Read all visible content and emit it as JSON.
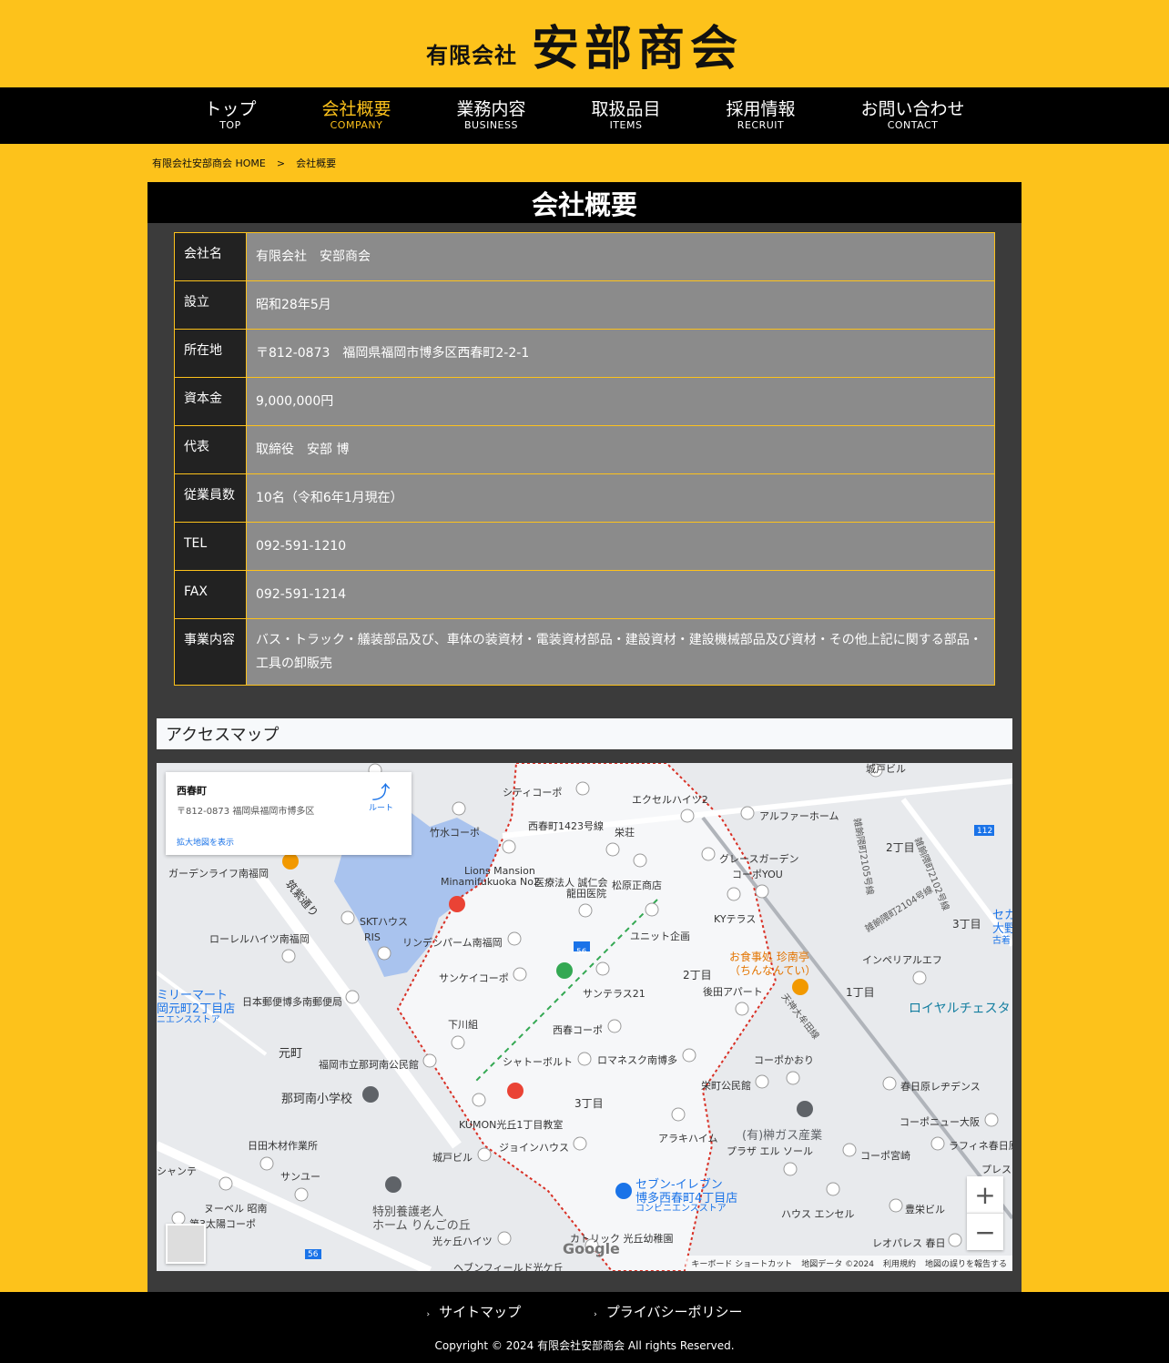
{
  "header": {
    "logo_small": "有限会社",
    "logo_big": "安部商会"
  },
  "nav": [
    {
      "jp": "トップ",
      "en": "TOP"
    },
    {
      "jp": "会社概要",
      "en": "COMPANY"
    },
    {
      "jp": "業務内容",
      "en": "BUSINESS"
    },
    {
      "jp": "取扱品目",
      "en": "ITEMS"
    },
    {
      "jp": "採用情報",
      "en": "RECRUIT"
    },
    {
      "jp": "お問い合わせ",
      "en": "CONTACT"
    }
  ],
  "breadcrumb": {
    "home": "有限会社安部商会 HOME",
    "separator": ">",
    "current": "会社概要"
  },
  "page_title": "会社概要",
  "company_table": [
    {
      "label": "会社名",
      "value": "有限会社　安部商会"
    },
    {
      "label": "設立",
      "value": "昭和28年5月"
    },
    {
      "label": "所在地",
      "value": "〒812-0873　福岡県福岡市博多区西春町2-2-1"
    },
    {
      "label": "資本金",
      "value": "9,000,000円"
    },
    {
      "label": "代表",
      "value": "取締役　安部 博"
    },
    {
      "label": "従業員数",
      "value": "10名（令和6年1月現在）"
    },
    {
      "label": "TEL",
      "value": "092-591-1210"
    },
    {
      "label": "FAX",
      "value": "092-591-1214"
    },
    {
      "label": "事業内容",
      "value": "バス・トラック・艤装部品及び、車体の装資材・電装資材部品・建設資材・建設機械部品及び資材・その他上記に関する部品・工具の卸販売"
    }
  ],
  "access": {
    "title": "アクセスマップ",
    "card": {
      "name": "西春町",
      "address": "〒812-0873 福岡県福岡市博多区",
      "link": "拡大地図を表示",
      "directions": "ルート"
    },
    "labels": {
      "l1": "シティコーポ",
      "l2": "エクセルハイツ2",
      "l3": "竹水コーポ",
      "l4": "西春町1423号線",
      "l5": "栄荘",
      "l6": "アルファーホーム",
      "l7": "グレースガーデン",
      "l8": "コーポYOU",
      "l9": "Lions Mansion",
      "l10": "Minamifukuoka No2",
      "l11": "医療法人 誠仁会",
      "l12": "龍田医院",
      "l13": "松原正商店",
      "l14": "ガーデンライフ南福岡",
      "l15": "SKTハウス",
      "l16": "RIS",
      "l17": "ローレルハイツ南福岡",
      "l18": "リンデンパーム南福岡",
      "l19": "ユニット企画",
      "l20": "KYテラス",
      "l21": "サンケイコーポ",
      "l22": "サンテラス21",
      "l23": "2丁目",
      "l24": "後田アパート",
      "l25": "インペリアルエフ",
      "l26": "1丁目",
      "l27": "3丁目",
      "l28": "2丁目",
      "l29": "日本郵便博多南郵便局",
      "l30": "下川組",
      "l31": "西春コーポ",
      "l32": "元町",
      "l33": "福岡市立那珂南公民館",
      "l34": "シャトーボルト",
      "l35": "ロマネスク南博多",
      "l36": "コーポかおり",
      "l37": "栄町公民館",
      "l38": "春日原レヂデンス",
      "l39": "那珂南小学校",
      "l40": "3丁目",
      "l41": "KUMON光丘1丁目教室",
      "l42": "アラキハイム",
      "l43": "コーポニュー大阪",
      "l44": "日田木材作業所",
      "l45": "城戸ビル",
      "l46": "ジョインハウス",
      "l47": "プラザ エル ソール",
      "l48": "コーポ宮崎",
      "l49": "ラフィネ春日原",
      "l50": "サンユー",
      "l51": "ヌーベル 昭南",
      "l52": "第3太陽コーポ",
      "l53": "光ヶ丘ハイツ",
      "l54": "カトリック 光丘幼稚園",
      "l55": "ヘブンフィールド光ケ丘",
      "l56": "ハウス エンセル",
      "l57": "豊栄ビル",
      "l58": "レオパレス 春日",
      "l59": "城戸ビル",
      "l60": "ミリーマート",
      "l61": "岡元町2丁目店",
      "l62": "ニエンスストア",
      "l63": "セブン-イレブン",
      "l64": "博多西春町4丁目店",
      "l65": "コンビニエンスストア",
      "l66": "特別養護老人",
      "l67": "ホーム りんごの丘",
      "l68": "お食事処 珍南亭",
      "l69": "（ちんなんてい）",
      "l70": "(有)榊ガス産業",
      "l71": "ロイヤルチェスタ",
      "l72": "天神大牟田線",
      "l73": "雑餉隈町2105号線",
      "l74": "雑餉隈町2104号線",
      "l75": "雑餉隈町2102号線",
      "l76": "筑紫通り",
      "l77": "シャンテ",
      "l78": "プレス",
      "l79": "セカ",
      "l80": "大野",
      "l81": "古着"
    },
    "attribution": [
      "キーボード ショートカット",
      "地図データ ©2024",
      "利用規約",
      "地図の誤りを報告する"
    ],
    "google": "Google",
    "zoom_in": "+",
    "zoom_out": "−",
    "route_numbers": {
      "r1": "56",
      "r2": "112",
      "r3": "56"
    }
  },
  "footer": {
    "links": [
      "サイトマップ",
      "プライバシーポリシー"
    ],
    "arrow": "›",
    "copyright": "Copyright © 2024 有限会社安部商会 All rights Reserved."
  },
  "colors": {
    "background": "#fdc21b",
    "nav_bg": "#000000",
    "panel_bg": "#3b3b3b",
    "cell_bg": "#8b8b8b",
    "active": "#fdc21b"
  }
}
